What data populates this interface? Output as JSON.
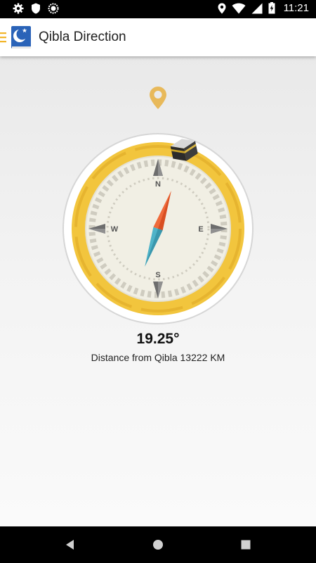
{
  "status_bar": {
    "time": "11:21",
    "icons": [
      "settings-icon",
      "shield-icon",
      "data-saver-icon",
      "location-icon",
      "wifi-icon",
      "signal-icon",
      "battery-icon"
    ]
  },
  "app_bar": {
    "title": "Qibla Direction",
    "icons": [
      "menu-icon",
      "app-logo-icon"
    ]
  },
  "compass": {
    "heading": "19.25°",
    "distance_text": "Distance from Qibla 13222 KM",
    "cardinals": {
      "north": "N",
      "south": "S",
      "east": "E",
      "west": "W"
    },
    "needle_angle_deg": 19.25,
    "colors": {
      "ring": "#f2c53d",
      "face": "#f1efe4",
      "needle_north": "#ef6a3a",
      "needle_south": "#4fb3c8",
      "ticks": "#cfccc0",
      "pin": "#e8b95a"
    }
  },
  "nav_bar": {
    "buttons": [
      "back-icon",
      "home-icon",
      "recents-icon"
    ]
  }
}
